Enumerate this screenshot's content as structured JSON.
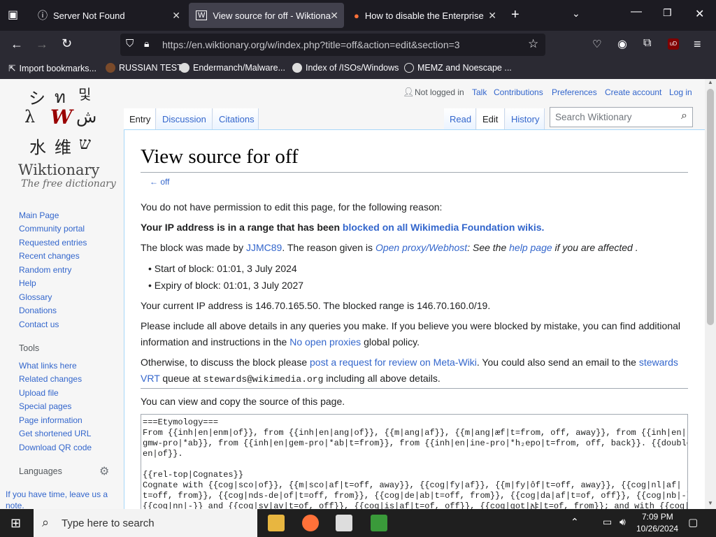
{
  "browser": {
    "tabs": [
      {
        "title": "Server Not Found"
      },
      {
        "title": "View source for off - Wiktionary"
      },
      {
        "title": "How to disable the Enterprise R"
      }
    ],
    "url": "https://en.wiktionary.org/w/index.php?title=off&action=edit&section=3",
    "bookmarks": [
      "Import bookmarks...",
      "RUSSIAN TEST",
      "Endermanch/Malware...",
      "Index of /ISOs/Windows",
      "MEMZ and Noescape ..."
    ]
  },
  "wiki": {
    "logo_glyphs": [
      "シ",
      "ท",
      "및",
      "λ",
      "W",
      "ش",
      "水",
      "维",
      "ש"
    ],
    "wordmark": "Wiktionary",
    "tagline": "The free dictionary",
    "nav": [
      "Main Page",
      "Community portal",
      "Requested entries",
      "Recent changes",
      "Random entry",
      "Help",
      "Glossary",
      "Donations",
      "Contact us"
    ],
    "tools_heading": "Tools",
    "tools": [
      "What links here",
      "Related changes",
      "Upload file",
      "Special pages",
      "Page information",
      "Get shortened URL",
      "Download QR code"
    ],
    "languages_heading": "Languages",
    "notice": "If you have time, leave us a note.",
    "personal": {
      "not_logged": "Not logged in",
      "talk": "Talk",
      "contribs": "Contributions",
      "prefs": "Preferences",
      "create": "Create account",
      "login": "Log in"
    },
    "tabs_left": [
      "Entry",
      "Discussion",
      "Citations"
    ],
    "tabs_right": [
      "Read",
      "Edit",
      "History"
    ],
    "search_placeholder": "Search Wiktionary",
    "heading": "View source for off",
    "back": "← off",
    "p1": "You do not have permission to edit this page, for the following reason:",
    "p2a": "Your IP address is in a range that has been ",
    "p2b": "blocked on all Wikimedia Foundation wikis.",
    "p3a": "The block was made by ",
    "p3b": "JJMC89",
    "p3c": ". The reason given is ",
    "p3d": "Open proxy/Webhost",
    "p3e": ": See the ",
    "p3f": "help page",
    "p3g": " if you are affected .",
    "start": "Start of block: 01:01, 3 July 2024",
    "expiry": "Expiry of block: 01:01, 3 July 2027",
    "p4": "Your current IP address is 146.70.165.50. The blocked range is 146.70.160.0/19.",
    "p5a": "Please include all above details in any queries you make. If you believe you were blocked by mistake, you can find additional",
    "p5b": "information and instructions in the ",
    "p5c": "No open proxies",
    "p5d": " global policy.",
    "p6a": "Otherwise, to discuss the block please ",
    "p6b": "post a request for review on Meta-Wiki",
    "p6c": ". You could also send an email to the ",
    "p6d": "stewards",
    "p6e": "VRT",
    "p6f": " queue at ",
    "p6g": "stewards@wikimedia.org",
    "p6h": " including all above details.",
    "p7": "You can view and copy the source of this page.",
    "source": "===Etymology===\nFrom {{inh|en|enm|of}}, from {{inh|en|ang|of}}, {{m|ang|af}}, {{m|ang|æf|t=from, off, away}}, from {{inh|en|\ngmw-pro|*ab}}, from {{inh|en|gem-pro|*ab|t=from}}, from {{inh|en|ine-pro|*h₂epo|t=from, off, back}}. {{doublet|\nen|of}}.\n\n{{rel-top|Cognates}}\nCognate with {{cog|sco|of}}, {{m|sco|af|t=off, away}}, {{cog|fy|af}}, {{m|fy|ôf|t=off, away}}, {{cog|nl|af|\nt=off, from}}, {{cog|nds-de|of|t=off, from}}, {{cog|de|ab|t=off, from}}, {{cog|da|af|t=of, off}}, {{cog|nb|-}},\n{{cog|nn|-}} and {{cog|sv|av|t=of, off}}, {{cog|is|af|t=of, off}}, {{cog|got|𐌰𐍆|t=of, from}}; and with {{cog|"
  },
  "taskbar": {
    "search": "Type here to search",
    "time": "7:09 PM",
    "date": "10/26/2024"
  }
}
